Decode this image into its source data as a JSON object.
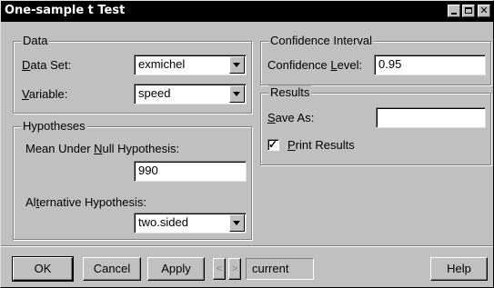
{
  "window": {
    "title": "One-sample t Test"
  },
  "data_group": {
    "legend": "Data",
    "dataset_label_underlined": "D",
    "dataset_label_rest": "ata Set:",
    "dataset_value": "exmichel",
    "variable_label_underlined": "V",
    "variable_label_rest": "ariable:",
    "variable_value": "speed"
  },
  "hypotheses_group": {
    "legend": "Hypotheses",
    "null_label_pre": "Mean Under ",
    "null_label_underlined": "N",
    "null_label_post": "ull Hypothesis:",
    "null_value": "990",
    "alt_label_pre": "Al",
    "alt_label_underlined": "t",
    "alt_label_post": "ernative Hypothesis:",
    "alt_value": "two.sided"
  },
  "confidence_group": {
    "legend": "Confidence Interval",
    "level_label_pre": "Confidence ",
    "level_label_underlined": "L",
    "level_label_post": "evel:",
    "level_value": "0.95"
  },
  "results_group": {
    "legend": "Results",
    "save_label_underlined": "S",
    "save_label_rest": "ave As:",
    "save_value": "",
    "print_checked": true,
    "print_label_underlined": "P",
    "print_label_rest": "rint Results"
  },
  "buttons": {
    "ok": "OK",
    "cancel": "Cancel",
    "apply": "Apply",
    "prev": "<",
    "next": ">",
    "current": "current",
    "help": "Help"
  }
}
